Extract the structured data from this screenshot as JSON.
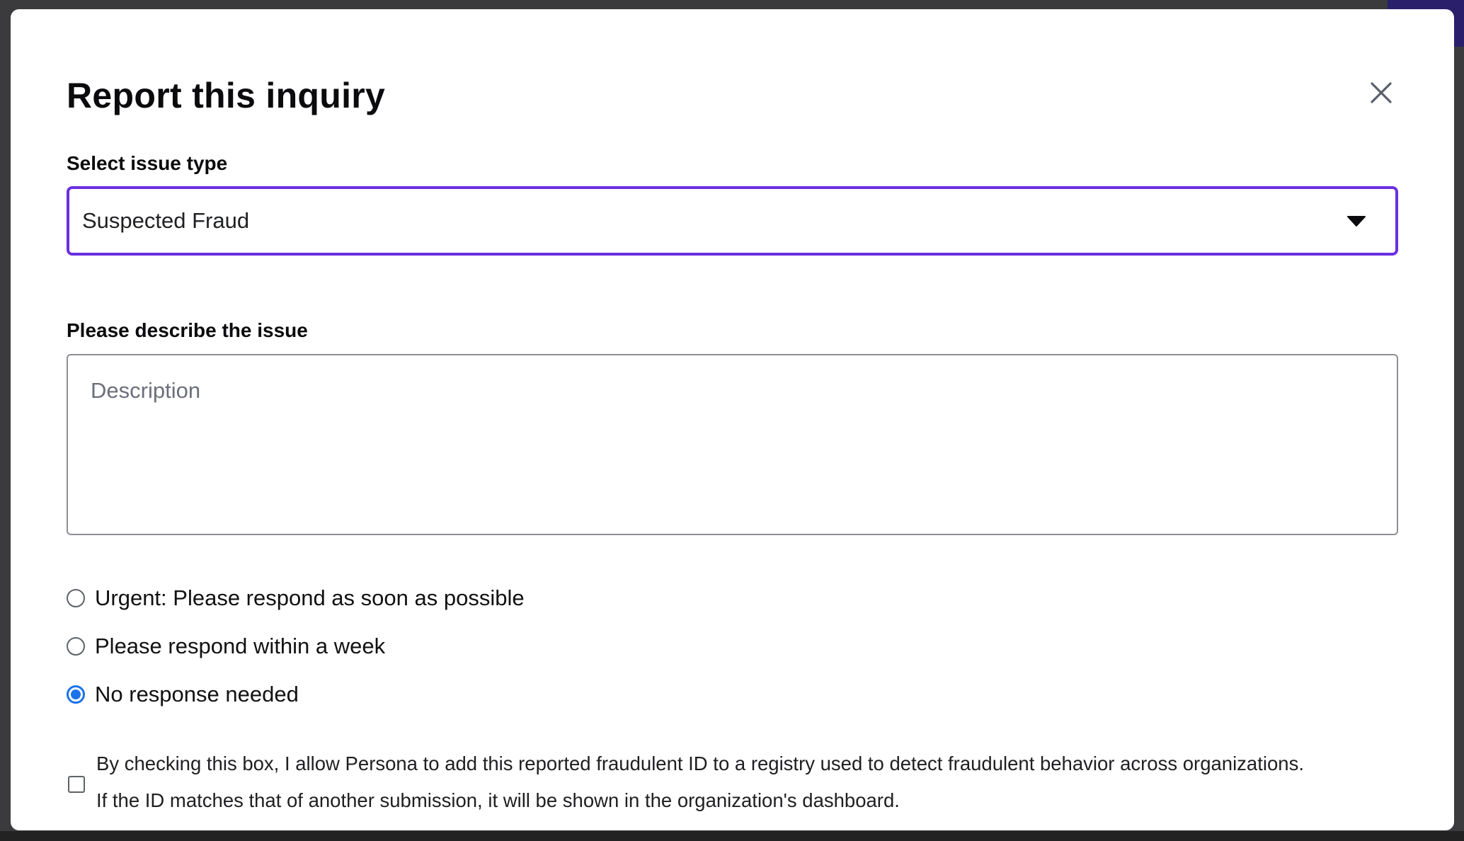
{
  "modal": {
    "title": "Report this inquiry",
    "close_icon": "close-icon"
  },
  "issue_type": {
    "label": "Select issue type",
    "selected_value": "Suspected Fraud",
    "dropdown_icon": "chevron-down-icon"
  },
  "description": {
    "label": "Please describe the issue",
    "placeholder": "Description",
    "value": ""
  },
  "response_options": [
    {
      "label": "Urgent: Please respond as soon as possible",
      "selected": false
    },
    {
      "label": "Please respond within a week",
      "selected": false
    },
    {
      "label": "No response needed",
      "selected": true
    }
  ],
  "consent": {
    "checked": false,
    "line1": "By checking this box, I allow Persona to add this reported fraudulent ID to a registry used to detect fraudulent behavior across organizations.",
    "line2": "If the ID matches that of another submission, it will be shown in the organization's dashboard."
  },
  "colors": {
    "select_focus_border": "#6b2fe0",
    "radio_selected": "#1a73e8",
    "backdrop": "#3b3b3d"
  }
}
